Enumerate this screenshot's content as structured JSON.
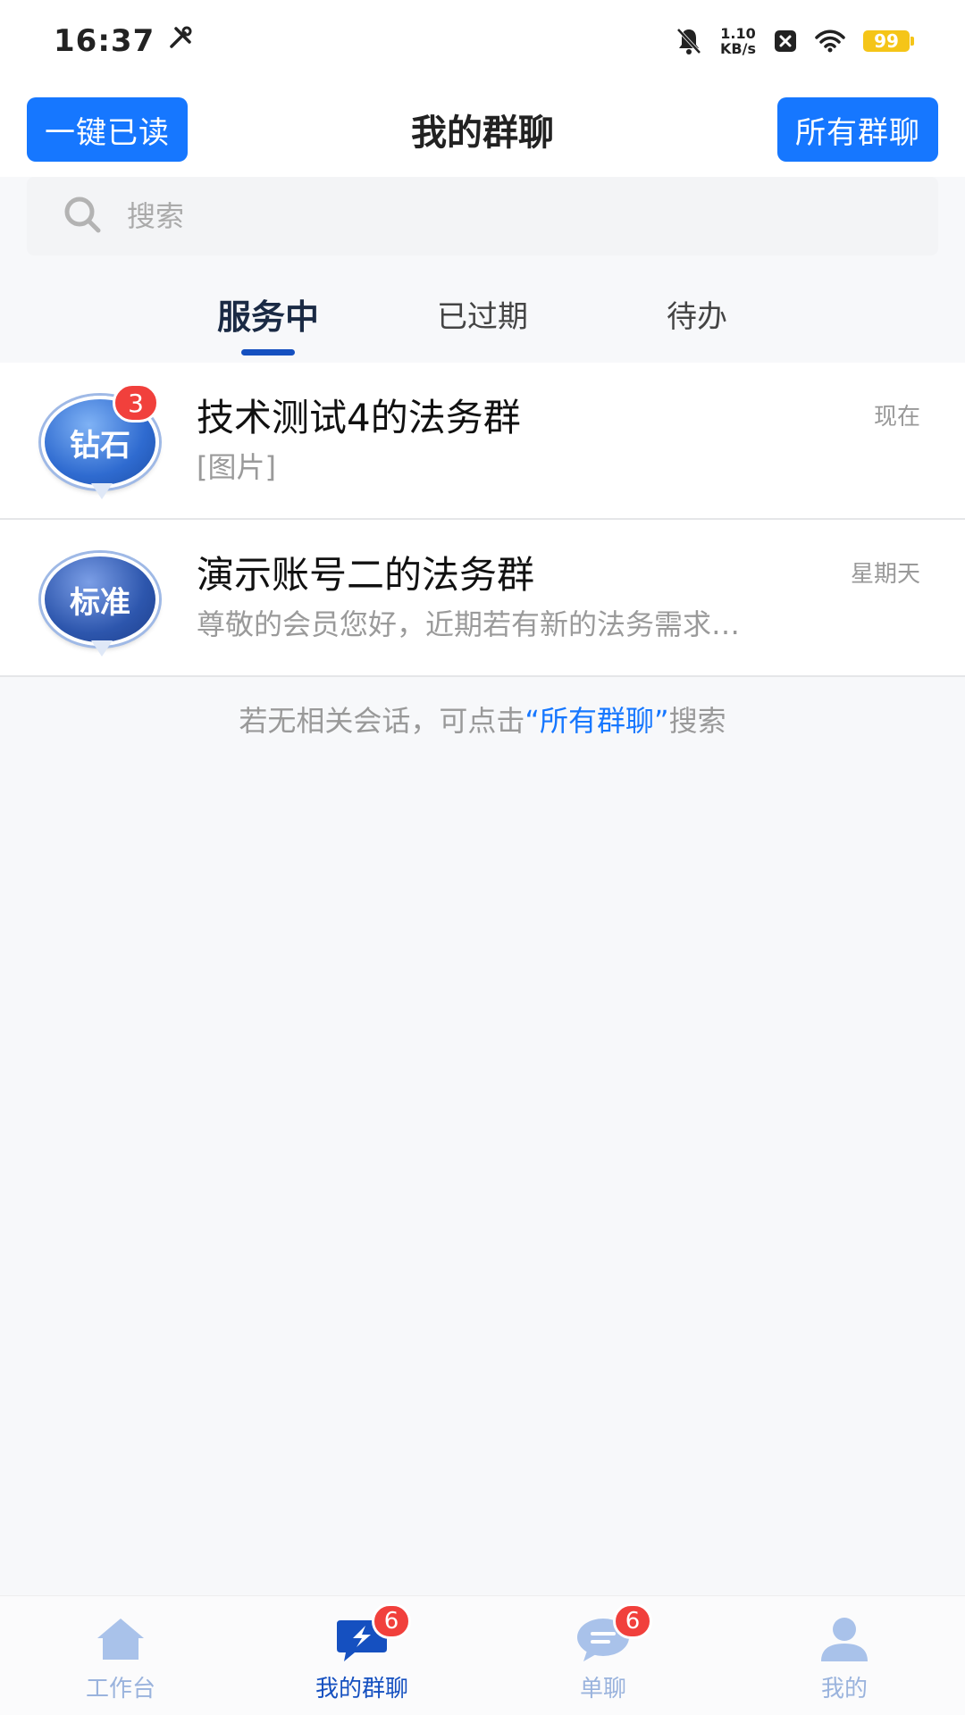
{
  "status_bar": {
    "time": "16:37",
    "net_speed_value": "1.10",
    "net_speed_unit": "KB/s",
    "battery": "99"
  },
  "header": {
    "mark_read_label": "一键已读",
    "title": "我的群聊",
    "all_groups_label": "所有群聊"
  },
  "search": {
    "placeholder": "搜索"
  },
  "tabs": [
    {
      "label": "服务中"
    },
    {
      "label": "已过期"
    },
    {
      "label": "待办"
    }
  ],
  "chats": [
    {
      "avatar_text": "钻石",
      "unread": "3",
      "name": "技术测试4的法务群",
      "preview": "[图片]",
      "time": "现在"
    },
    {
      "avatar_text": "标准",
      "unread": "",
      "name": "演示账号二的法务群",
      "preview": "尊敬的会员您好，近期若有新的法务需求…",
      "time": "星期天"
    }
  ],
  "hint": {
    "prefix": "若无相关会话，可点击",
    "link": "“所有群聊”",
    "suffix": "搜索"
  },
  "bottom_nav": [
    {
      "label": "工作台",
      "badge": ""
    },
    {
      "label": "我的群聊",
      "badge": "6"
    },
    {
      "label": "单聊",
      "badge": "6"
    },
    {
      "label": "我的",
      "badge": ""
    }
  ],
  "colors": {
    "primary": "#1677ff",
    "tab_indicator": "#1550c0",
    "badge": "#f1403c"
  }
}
